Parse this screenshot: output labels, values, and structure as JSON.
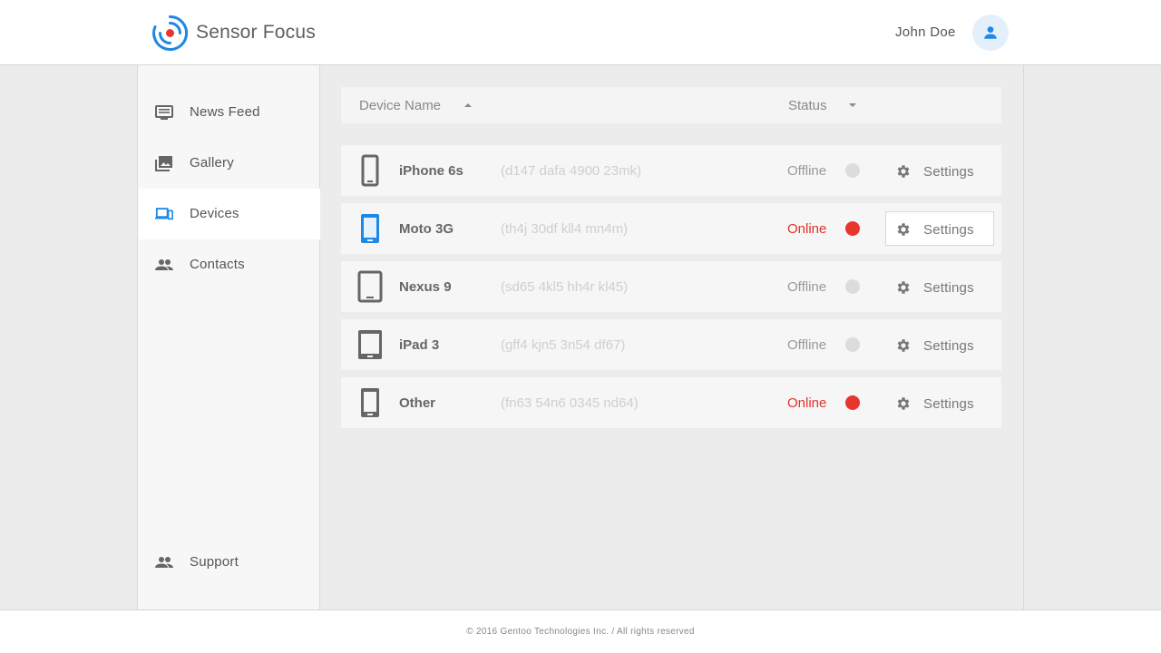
{
  "app": {
    "brand": "Sensor Focus",
    "accent_color": "#1e88e5",
    "logo_icon": "sensor-target-logo"
  },
  "header": {
    "user_name": "John Doe",
    "avatar_icon": "person-icon"
  },
  "sidebar": {
    "items": [
      {
        "label": "News Feed",
        "icon": "news-feed-icon",
        "active": false
      },
      {
        "label": "Gallery",
        "icon": "gallery-icon",
        "active": false
      },
      {
        "label": "Devices",
        "icon": "devices-icon",
        "active": true
      },
      {
        "label": "Contacts",
        "icon": "contacts-icon",
        "active": false
      }
    ],
    "bottom_item": {
      "label": "Support",
      "icon": "support-icon"
    }
  },
  "table": {
    "columns": [
      {
        "label": "Device Name",
        "sort": "ascending"
      },
      {
        "label": "Status",
        "sort": "dropdown"
      }
    ],
    "rows": [
      {
        "name": "iPhone 6s",
        "id": "(d147 dafa 4900 23mk)",
        "status": "Offline",
        "online": false,
        "device_icon": "phone-icon",
        "settings_label": "Settings"
      },
      {
        "name": "Moto 3G",
        "id": "(th4j 30df kll4 mn4m)",
        "status": "Online",
        "online": true,
        "device_icon": "phone-icon",
        "settings_label": "Settings"
      },
      {
        "name": "Nexus 9",
        "id": "(sd65 4kl5 hh4r kl45)",
        "status": "Offline",
        "online": false,
        "device_icon": "tablet-icon",
        "settings_label": "Settings"
      },
      {
        "name": "iPad 3",
        "id": "(gff4 kjn5 3n54 df67)",
        "status": "Offline",
        "online": false,
        "device_icon": "tablet-icon",
        "settings_label": "Settings"
      },
      {
        "name": "Other",
        "id": "(fn63 54n6 0345 nd64)",
        "status": "Online",
        "online": true,
        "device_icon": "phone-icon",
        "settings_label": "Settings"
      }
    ]
  },
  "colors": {
    "online": "#e8362e",
    "offline": "#dcdcdc",
    "active_icon": "#1e88e5"
  },
  "footer": {
    "text": "© 2016 Gentoo Technologies Inc.  /  All rights reserved"
  }
}
